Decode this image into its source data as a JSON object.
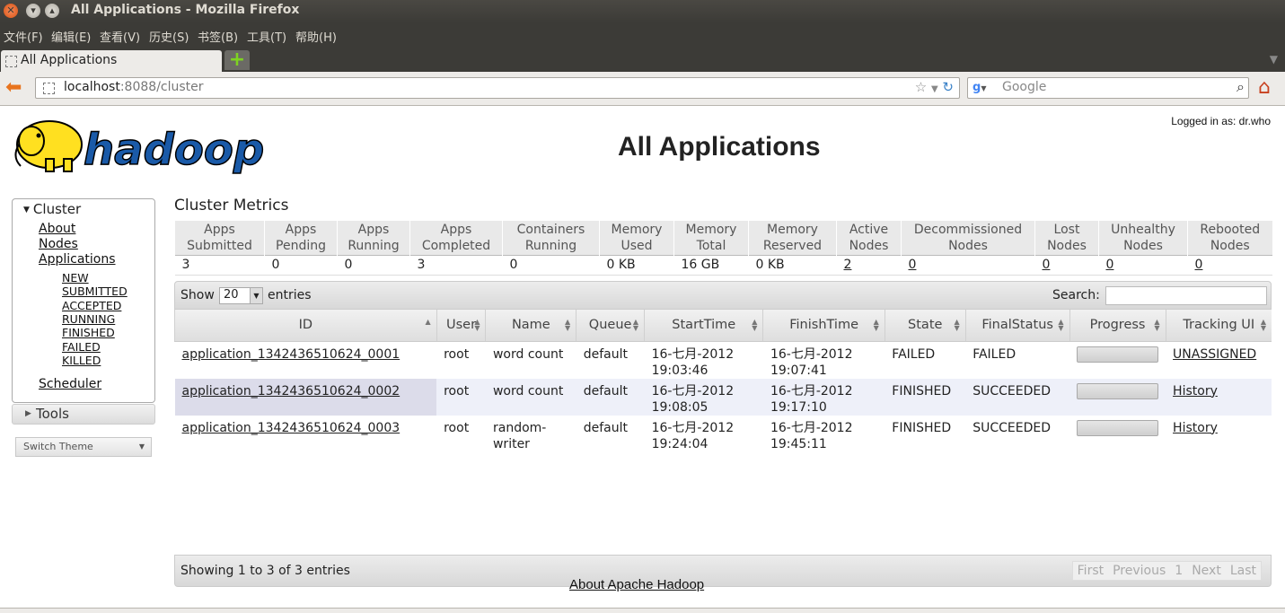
{
  "window": {
    "title": "All Applications - Mozilla Firefox"
  },
  "menu": [
    "文件(F)",
    "编辑(E)",
    "查看(V)",
    "历史(S)",
    "书签(B)",
    "工具(T)",
    "帮助(H)"
  ],
  "tab": {
    "label": "All Applications",
    "new_tab_glyph": "+"
  },
  "url": {
    "host": "localhost",
    "rest": ":8088/cluster"
  },
  "search": {
    "placeholder": "Google"
  },
  "page": {
    "logged_in": "Logged in as: dr.who",
    "title": "All Applications",
    "logo_text": "hadoop"
  },
  "sidebar": {
    "cluster_label": "Cluster",
    "links": [
      "About",
      "Nodes",
      "Applications"
    ],
    "app_states": [
      "NEW",
      "SUBMITTED",
      "ACCEPTED",
      "RUNNING",
      "FINISHED",
      "FAILED",
      "KILLED"
    ],
    "scheduler": "Scheduler",
    "tools_label": "Tools",
    "switch_theme": "Switch Theme"
  },
  "metrics": {
    "title": "Cluster Metrics",
    "headers": [
      [
        "Apps",
        "Submitted"
      ],
      [
        "Apps",
        "Pending"
      ],
      [
        "Apps",
        "Running"
      ],
      [
        "Apps",
        "Completed"
      ],
      [
        "Containers",
        "Running"
      ],
      [
        "Memory",
        "Used"
      ],
      [
        "Memory",
        "Total"
      ],
      [
        "Memory",
        "Reserved"
      ],
      [
        "Active",
        "Nodes"
      ],
      [
        "Decommissioned",
        "Nodes"
      ],
      [
        "Lost",
        "Nodes"
      ],
      [
        "Unhealthy",
        "Nodes"
      ],
      [
        "Rebooted",
        "Nodes"
      ]
    ],
    "values": [
      "3",
      "0",
      "0",
      "3",
      "0",
      "0 KB",
      "16 GB",
      "0 KB",
      "2",
      "0",
      "0",
      "0",
      "0"
    ]
  },
  "apps_table": {
    "show_label": "Show",
    "page_length": "20",
    "entries_label": "entries",
    "search_label": "Search:",
    "columns": [
      [
        "ID"
      ],
      [
        "User"
      ],
      [
        "Name"
      ],
      [
        "Queue"
      ],
      [
        "StartTime"
      ],
      [
        "FinishTime"
      ],
      [
        "State"
      ],
      [
        "FinalStatus"
      ],
      [
        "Progress"
      ],
      [
        "Tracking UI"
      ]
    ],
    "rows": [
      {
        "id": "application_1342436510624_0001",
        "user": "root",
        "name": "word count",
        "queue": "default",
        "start": [
          "16-七月-2012",
          "19:03:46"
        ],
        "finish": [
          "16-七月-2012",
          "19:07:41"
        ],
        "state": "FAILED",
        "final": "FAILED",
        "progress": 0,
        "tracking": "UNASSIGNED"
      },
      {
        "id": "application_1342436510624_0002",
        "user": "root",
        "name": "word count",
        "queue": "default",
        "start": [
          "16-七月-2012",
          "19:08:05"
        ],
        "finish": [
          "16-七月-2012",
          "19:17:10"
        ],
        "state": "FINISHED",
        "final": "SUCCEEDED",
        "progress": 0,
        "tracking": "History"
      },
      {
        "id": "application_1342436510624_0003",
        "user": "root",
        "name": "random-writer",
        "queue": "default",
        "start": [
          "16-七月-2012",
          "19:24:04"
        ],
        "finish": [
          "16-七月-2012",
          "19:45:11"
        ],
        "state": "FINISHED",
        "final": "SUCCEEDED",
        "progress": 0,
        "tracking": "History"
      }
    ],
    "info": "Showing 1 to 3 of 3 entries",
    "pager": [
      "First",
      "Previous",
      "1",
      "Next",
      "Last"
    ]
  },
  "footer": {
    "about": "About Apache Hadoop"
  },
  "colors": {
    "titlebar": "#3c3b37",
    "logo_yellow": "#ffe020",
    "logo_blue": "#1a5aa8"
  }
}
